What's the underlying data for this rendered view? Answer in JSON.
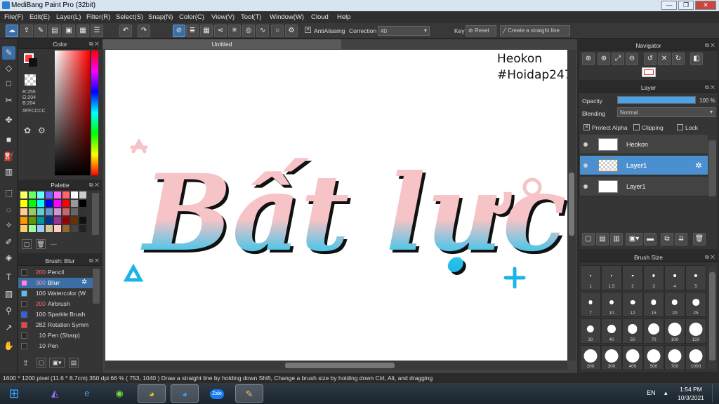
{
  "window": {
    "title": "MediBang Paint Pro (32bit)"
  },
  "menu": [
    "File(F)",
    "Edit(E)",
    "Layer(L)",
    "Filter(R)",
    "Select(S)",
    "Snap(N)",
    "Color(C)",
    "View(V)",
    "Tool(T)",
    "Window(W)",
    "Cloud",
    "Help"
  ],
  "toolbar": {
    "antialiasing_label": "AntiAliasing",
    "correction_label": "Correction",
    "correction_value": "40",
    "key_label": "Key",
    "reset_label": "Reset",
    "straight_line_label": "Create a straight line"
  },
  "color_panel": {
    "title": "Color",
    "r": "R:255",
    "g": "G:204",
    "b": "B:204",
    "hex": "#FFCCCC",
    "primary_color": "#ff3b3b",
    "secondary_color": "#ffffff"
  },
  "palette_panel": {
    "title": "Palette",
    "more_label": "---"
  },
  "brush_panel": {
    "title": "Brush: Blur",
    "items": [
      {
        "size": "200",
        "name": "Pencil",
        "color": "#2a2a2a",
        "size_color": "#ff6a6a"
      },
      {
        "size": "300",
        "name": "Blur",
        "color": "#ff80ff",
        "size_color": "#ff9a9a",
        "selected": true
      },
      {
        "size": "100",
        "name": "Watercolor (W",
        "color": "#4fc3f7",
        "size_color": "#dddddd"
      },
      {
        "size": "200",
        "name": "Airbrush",
        "color": "#2a2a2a",
        "size_color": "#ff6a6a"
      },
      {
        "size": "100",
        "name": "Sparkle Brush",
        "color": "#2c5cff",
        "size_color": "#dddddd"
      },
      {
        "size": "282",
        "name": "Rotation Symm",
        "color": "#ff3b3b",
        "size_color": "#dddddd"
      },
      {
        "size": "10",
        "name": "Pen (Sharp)",
        "color": "#2a2a2a",
        "size_color": "#dddddd"
      },
      {
        "size": "10",
        "name": "Pen",
        "color": "#2a2a2a",
        "size_color": "#dddddd"
      }
    ]
  },
  "canvas": {
    "tab_title": "Untitled",
    "watermark_line1": "Heokon",
    "watermark_line2": "#Hoidap247",
    "art_text": "Bất lực"
  },
  "navigator": {
    "title": "Navigator"
  },
  "layer_panel": {
    "title": "Layer",
    "opacity_label": "Opacity",
    "opacity_value": 100,
    "opacity_text": "100 %",
    "blending_label": "Blending",
    "blending_value": "Normal",
    "protect_alpha_label": "Protect Alpha",
    "clipping_label": "Clipping",
    "lock_label": "Lock",
    "layers": [
      {
        "name": "Heokon",
        "selected": false
      },
      {
        "name": "Layer1",
        "selected": true
      },
      {
        "name": "Layer1",
        "selected": false
      }
    ]
  },
  "brush_size_panel": {
    "title": "Brush Size",
    "sizes": [
      "1",
      "1.5",
      "2",
      "3",
      "4",
      "5",
      "7",
      "10",
      "12",
      "15",
      "20",
      "25",
      "30",
      "40",
      "50",
      "70",
      "100",
      "150",
      "200",
      "300",
      "400",
      "500",
      "700",
      "1000"
    ]
  },
  "status": {
    "text": "1600 * 1200 pixel  (11.6 * 8.7cm)  350 dpi  66 %  ( 753, 1040 )  Draw a straight line by holding down Shift, Change a brush size by holding down Ctrl, Alt, and dragging"
  },
  "taskbar": {
    "lang": "EN",
    "time": "1:54 PM",
    "date": "10/3/2021",
    "zalo_label": "Zalo"
  }
}
